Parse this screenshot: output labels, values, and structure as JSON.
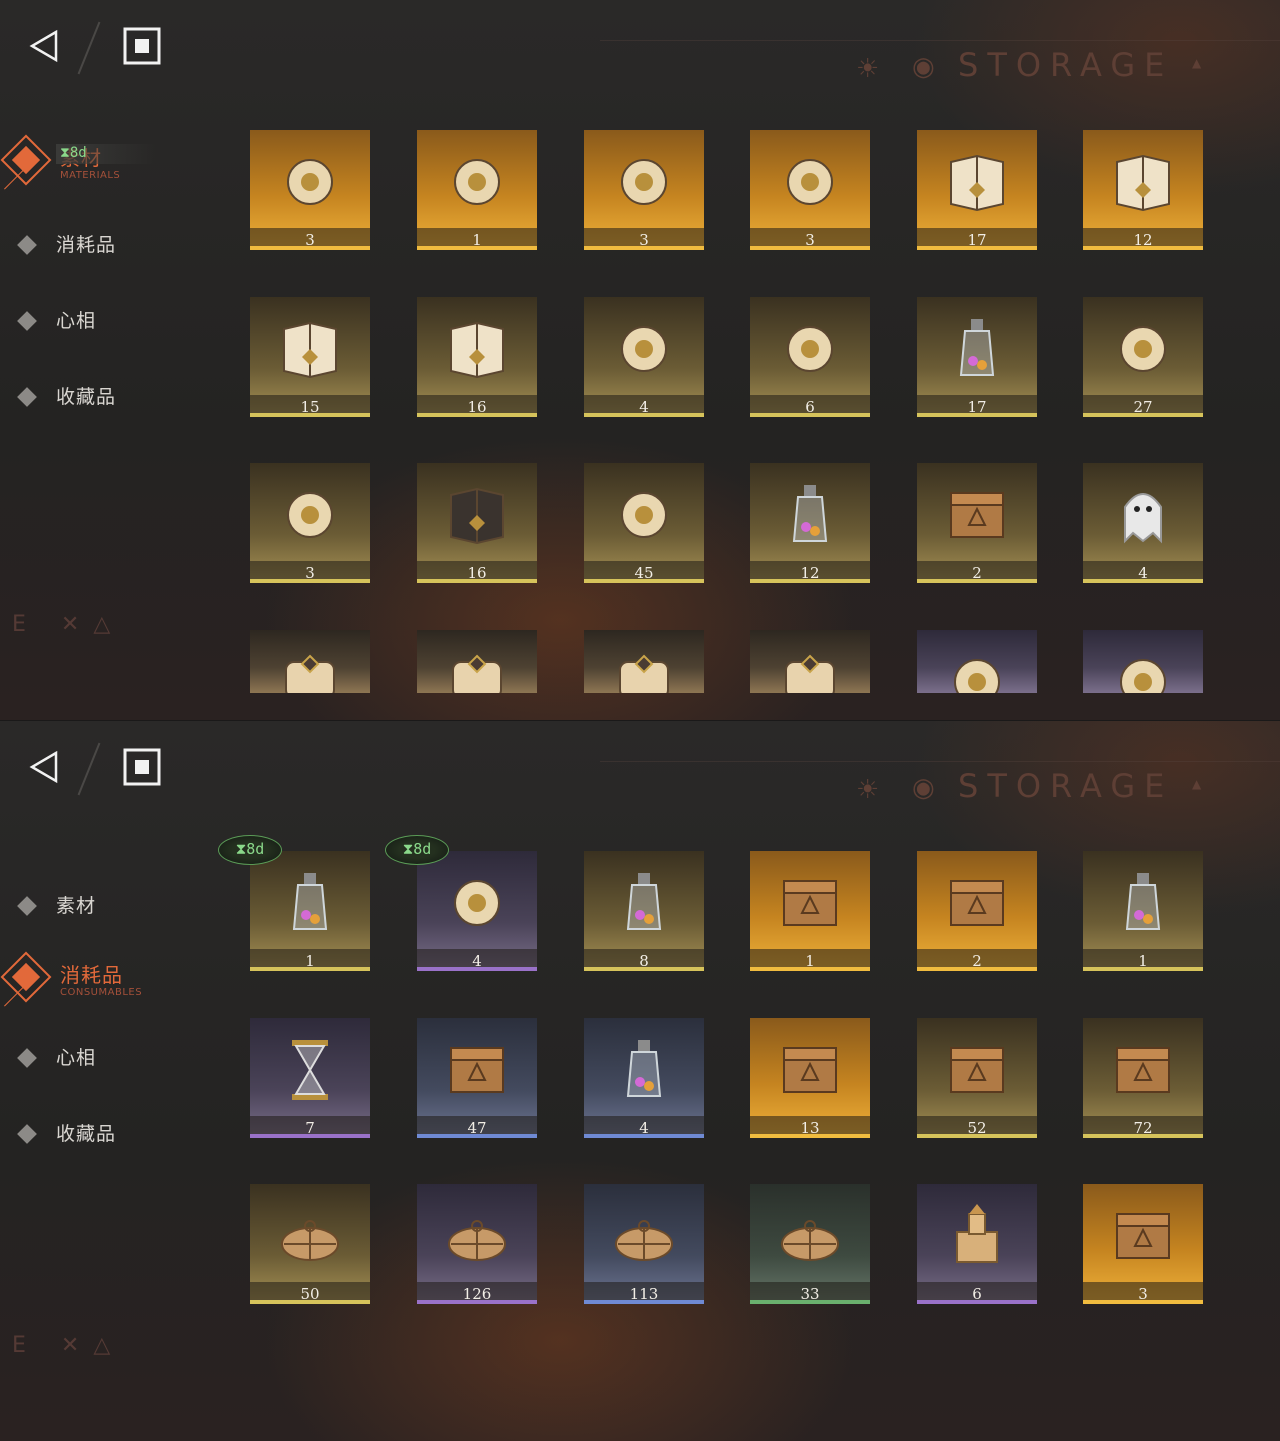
{
  "screens": [
    {
      "title": "STORAGE",
      "active_tab": "materials",
      "nav": [
        {
          "key": "materials",
          "label": "素材",
          "sub": "MATERIALS",
          "active": true
        },
        {
          "key": "consumables",
          "label": "消耗品",
          "sub": "",
          "active": false,
          "timer": "8d"
        },
        {
          "key": "psychube",
          "label": "心相",
          "sub": "",
          "active": false
        },
        {
          "key": "collection",
          "label": "收藏品",
          "sub": "",
          "active": false
        }
      ],
      "items": [
        {
          "qty": "3",
          "tier": "gold",
          "icon": "caduceus-icon"
        },
        {
          "qty": "1",
          "tier": "gold",
          "icon": "golden-sheep-icon"
        },
        {
          "qty": "3",
          "tier": "gold",
          "icon": "laurel-wreath-icon"
        },
        {
          "qty": "3",
          "tier": "gold",
          "icon": "snake-apple-icon"
        },
        {
          "qty": "17",
          "tier": "gold",
          "icon": "red-tome-icon"
        },
        {
          "qty": "12",
          "tier": "gold",
          "icon": "green-tome-icon"
        },
        {
          "qty": "15",
          "tier": "yellow",
          "icon": "blue-tome-icon"
        },
        {
          "qty": "16",
          "tier": "yellow",
          "icon": "gold-tome-icon"
        },
        {
          "qty": "4",
          "tier": "yellow",
          "icon": "astrolabe-icon"
        },
        {
          "qty": "6",
          "tier": "yellow",
          "icon": "ouija-board-icon"
        },
        {
          "qty": "17",
          "tier": "yellow",
          "icon": "potion-bottle-icon"
        },
        {
          "qty": "27",
          "tier": "yellow",
          "icon": "pocket-watch-icon"
        },
        {
          "qty": "3",
          "tier": "yellow",
          "icon": "firefly-icon"
        },
        {
          "qty": "16",
          "tier": "yellow",
          "icon": "black-grimoire-icon"
        },
        {
          "qty": "45",
          "tier": "yellow",
          "icon": "silver-bullets-icon"
        },
        {
          "qty": "12",
          "tier": "yellow",
          "icon": "bell-jar-icon"
        },
        {
          "qty": "2",
          "tier": "yellow",
          "icon": "hand-box-icon"
        },
        {
          "qty": "4",
          "tier": "yellow",
          "icon": "ghost-icon"
        },
        {
          "qty": "",
          "tier": "brown",
          "icon": "red-scroll-icon"
        },
        {
          "qty": "",
          "tier": "brown",
          "icon": "green-scroll-icon"
        },
        {
          "qty": "",
          "tier": "brown",
          "icon": "blue-scroll-icon"
        },
        {
          "qty": "",
          "tier": "brown",
          "icon": "gold-scroll-icon"
        },
        {
          "qty": "",
          "tier": "purple",
          "icon": "amulet-icon"
        },
        {
          "qty": "",
          "tier": "purple",
          "icon": "tentacle-icon"
        }
      ]
    },
    {
      "title": "STORAGE",
      "active_tab": "consumables",
      "nav": [
        {
          "key": "materials",
          "label": "素材",
          "sub": "",
          "active": false
        },
        {
          "key": "consumables",
          "label": "消耗品",
          "sub": "CONSUMABLES",
          "active": true
        },
        {
          "key": "psychube",
          "label": "心相",
          "sub": "",
          "active": false
        },
        {
          "key": "collection",
          "label": "收藏品",
          "sub": "",
          "active": false
        }
      ],
      "items": [
        {
          "qty": "1",
          "tier": "yellow",
          "icon": "candy-jar-icon",
          "badge": "8d"
        },
        {
          "qty": "4",
          "tier": "purple",
          "icon": "lollipop-icon",
          "badge": "8d"
        },
        {
          "qty": "8",
          "tier": "yellow",
          "icon": "candy-jar-icon"
        },
        {
          "qty": "1",
          "tier": "gold",
          "icon": "photo-box-icon"
        },
        {
          "qty": "2",
          "tier": "gold",
          "icon": "rune-chest-icon"
        },
        {
          "qty": "1",
          "tier": "yellow",
          "icon": "message-bottle-icon"
        },
        {
          "qty": "7",
          "tier": "purple",
          "icon": "hourglass-icon"
        },
        {
          "qty": "47",
          "tier": "blue",
          "icon": "wooden-crate-icon"
        },
        {
          "qty": "4",
          "tier": "blue",
          "icon": "message-bottle-icon"
        },
        {
          "qty": "13",
          "tier": "gold",
          "icon": "wooden-crate-icon"
        },
        {
          "qty": "52",
          "tier": "yellow",
          "icon": "wooden-crate-icon"
        },
        {
          "qty": "72",
          "tier": "yellow",
          "icon": "wooden-crate-icon"
        },
        {
          "qty": "50",
          "tier": "yellow",
          "icon": "parcel-icon"
        },
        {
          "qty": "126",
          "tier": "purple",
          "icon": "parcel-icon"
        },
        {
          "qty": "113",
          "tier": "blue",
          "icon": "parcel-icon"
        },
        {
          "qty": "33",
          "tier": "green",
          "icon": "parcel-icon"
        },
        {
          "qty": "6",
          "tier": "purple",
          "icon": "toy-castle-icon"
        },
        {
          "qty": "3",
          "tier": "gold",
          "icon": "rabbit-box-icon"
        }
      ]
    }
  ],
  "colors": {
    "accent": "#e2693a",
    "timer": "#8ad88a",
    "gold": "#f1bc3f",
    "yellow": "#d6c35b",
    "purple": "#9a72c9",
    "blue": "#6f8ad4",
    "green": "#6ab06e"
  }
}
